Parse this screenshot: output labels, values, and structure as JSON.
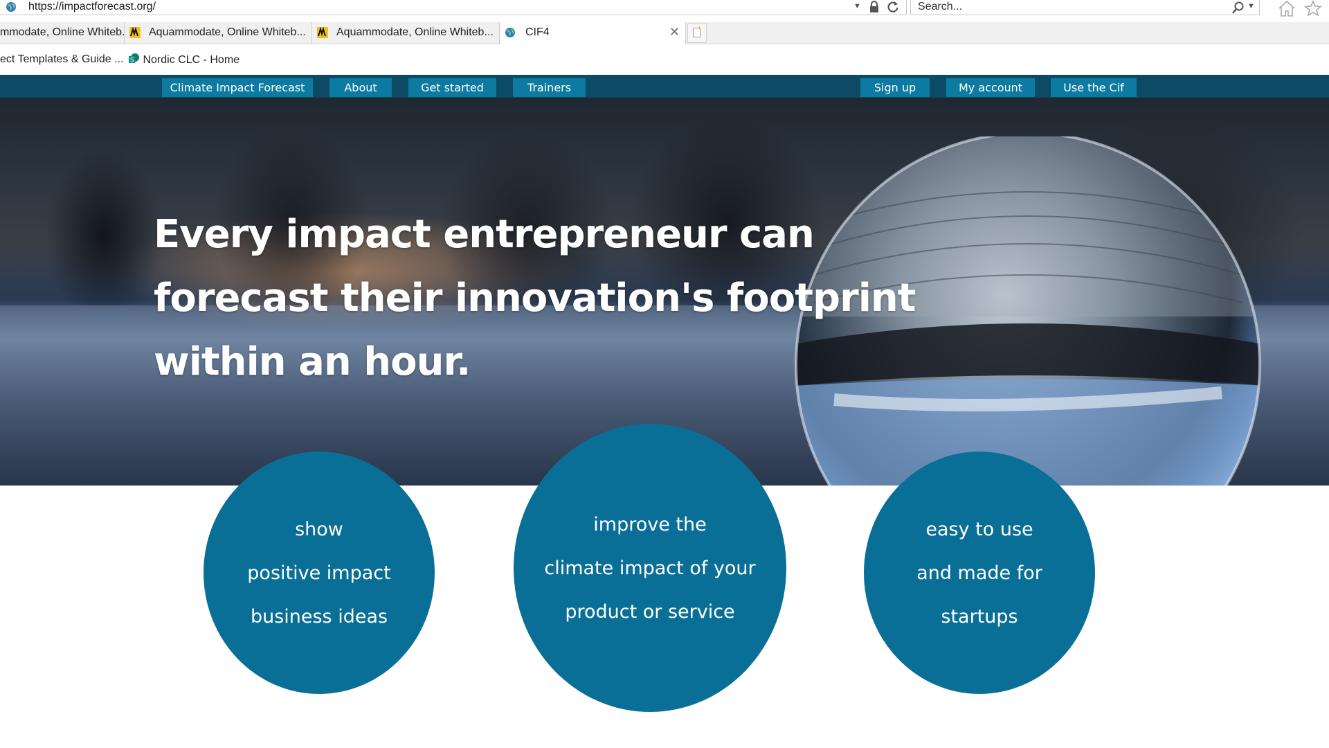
{
  "browser": {
    "url": "https://impactforecast.org/",
    "search_placeholder": "Search...",
    "tabs": [
      {
        "label": "mmodate, Online Whiteb..."
      },
      {
        "label": "Aquammodate, Online Whiteb..."
      },
      {
        "label": "Aquammodate, Online Whiteb..."
      },
      {
        "label": "CIF4",
        "active": true
      }
    ],
    "favorites": [
      {
        "label": "ect Templates & Guide ..."
      },
      {
        "label": "Nordic CLC - Home"
      }
    ],
    "icons": [
      "globe-icon",
      "lock-icon",
      "refresh-icon",
      "search-icon",
      "home-icon",
      "star-icon",
      "close-icon",
      "new-tab-icon"
    ]
  },
  "nav": {
    "left": [
      "Climate Impact Forecast",
      "About",
      "Get started",
      "Trainers"
    ],
    "right": [
      "Sign up",
      "My account",
      "Use the Cif"
    ]
  },
  "hero": {
    "headline_lines": [
      "Every impact entrepreneur can",
      "forecast their innovation's footprint",
      "within an hour."
    ]
  },
  "features": [
    {
      "lines": [
        "show",
        "positive impact",
        "business ideas"
      ]
    },
    {
      "lines": [
        "improve the",
        "climate impact of your",
        "product or service"
      ]
    },
    {
      "lines": [
        "easy to use",
        "and made for",
        "startups"
      ]
    }
  ],
  "colors": {
    "nav_bar": "#0c4a66",
    "nav_button": "#0d7aa1",
    "circle": "#0a6f96",
    "text_on_brand": "#ffffff"
  }
}
